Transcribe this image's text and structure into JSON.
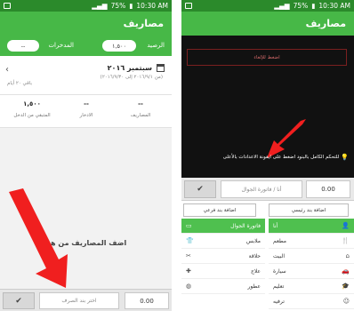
{
  "status": {
    "time": "10:30 AM",
    "battery": "75%"
  },
  "left": {
    "title": "مصاريف",
    "balance_label": "الرصيد",
    "balance_value": "١,٥٠٠",
    "savings_label": "المدخرات",
    "savings_value": "--",
    "month": "سبتمبر ٢٠١٦",
    "date_range": "(من ٢٠١٦/٩/١ إلى ٢٠١٦/٩/٣٠)",
    "remaining": "باقي ٢٠ أيام",
    "stats": [
      {
        "value": "١,٥٠٠",
        "label": "المتبقي من الدخل"
      },
      {
        "value": "--",
        "label": "الادخار"
      },
      {
        "value": "--",
        "label": "المصاريف"
      }
    ],
    "empty_message": "اضف المصاريف من هنا",
    "category_placeholder": "اختر بند الصرف",
    "amount": "0.00",
    "check": "✔"
  },
  "right": {
    "title": "مصاريف",
    "red_field": "اضغط للإلغاء",
    "hint": "للتحكم الكامل بالبنود اضغط على ايقونة الاعدادات بالأعلى",
    "category_value": "أنا / فاتورة الجوال",
    "amount": "0.00",
    "check": "✔",
    "add_sub": "اضافة بند فرعي",
    "add_main": "اضافة بند رئيسي",
    "sub_items": [
      {
        "label": "فاتورة الجوال",
        "icon": "▭"
      },
      {
        "label": "ملابس",
        "icon": "👕"
      },
      {
        "label": "حلاقة",
        "icon": "✂"
      },
      {
        "label": "علاج",
        "icon": "✚"
      },
      {
        "label": "عطور",
        "icon": "◍"
      }
    ],
    "main_items": [
      {
        "label": "أنا",
        "icon": "👤"
      },
      {
        "label": "مطعم",
        "icon": "🍴"
      },
      {
        "label": "البيت",
        "icon": "⌂"
      },
      {
        "label": "سيارة",
        "icon": "🚗"
      },
      {
        "label": "تعليم",
        "icon": "🎓"
      },
      {
        "label": "ترفيه",
        "icon": "☺"
      }
    ]
  }
}
